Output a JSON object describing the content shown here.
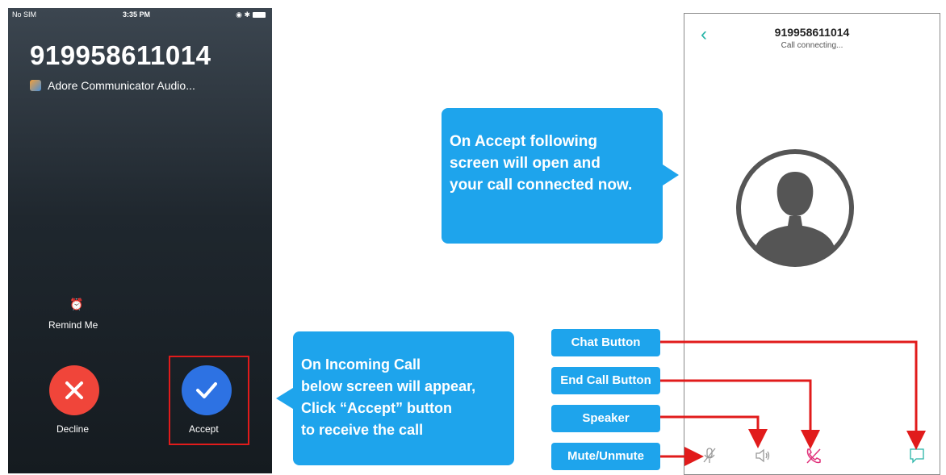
{
  "incoming_screen": {
    "status_bar": {
      "carrier": "No SIM",
      "time": "3:35 PM",
      "wifi_icon": "wifi-icon",
      "battery_icon": "battery-icon"
    },
    "caller_number": "919958611014",
    "app_name": "Adore Communicator Audio...",
    "remind_me_label": "Remind Me",
    "decline_label": "Decline",
    "accept_label": "Accept",
    "decline_color": "#f0453a",
    "accept_color": "#2d72e3"
  },
  "callouts": {
    "accept_info": [
      "On Accept following",
      "screen will open and",
      "your call connected now."
    ],
    "incoming_info": [
      "On Incoming Call",
      "below screen will appear,",
      "Click “Accept” button",
      "to receive the call"
    ]
  },
  "call_screen": {
    "number": "919958611014",
    "status": "Call connecting...",
    "accent_color": "#29b5a8",
    "icons": [
      "back-icon",
      "avatar-icon",
      "mute-icon",
      "speaker-icon",
      "end-call-icon",
      "chat-icon"
    ]
  },
  "labels": {
    "chat": "Chat Button",
    "end_call": "End Call Button",
    "speaker": "Speaker",
    "mute": "Mute/Unmute"
  },
  "colors": {
    "callout_blue": "#1ea4ec",
    "arrow_red": "#e11b1b"
  }
}
